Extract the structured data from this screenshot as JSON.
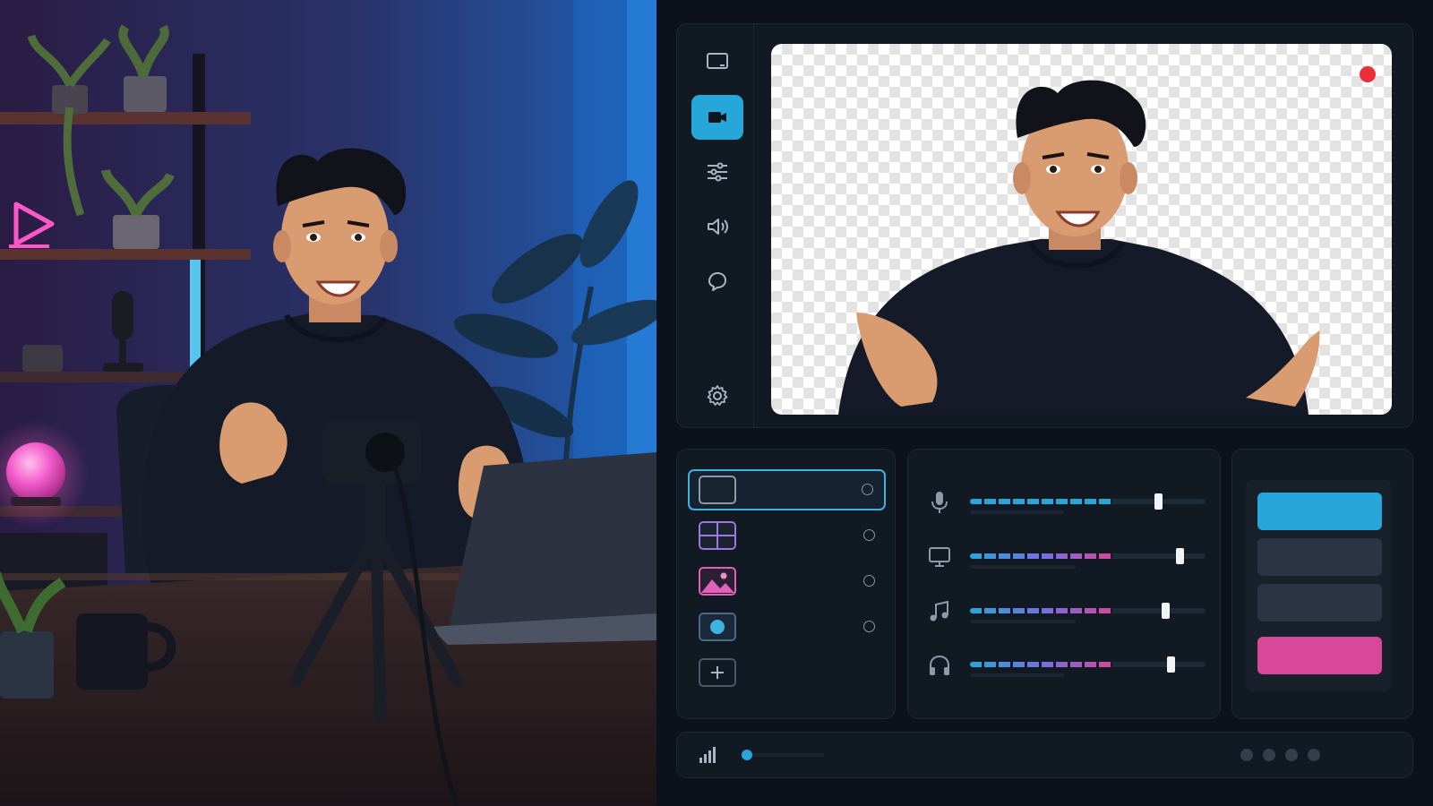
{
  "colors": {
    "accent": "#27a6d9",
    "record": "#ec2e3a",
    "scene_highlight": "#d7479a",
    "meter_gradient": [
      "#27a6d9",
      "#7a6ce0",
      "#d7479a"
    ]
  },
  "scene_illustration": {
    "neon_sign_icon": "play-icon"
  },
  "sidebar": {
    "items": [
      {
        "icon": "screen-icon",
        "active": false
      },
      {
        "icon": "video-camera-icon",
        "active": true
      },
      {
        "icon": "sliders-icon",
        "active": false
      },
      {
        "icon": "speaker-icon",
        "active": false
      },
      {
        "icon": "chat-bubble-icon",
        "active": false
      },
      {
        "icon": "gear-icon",
        "active": false
      }
    ]
  },
  "preview": {
    "recording": true,
    "background": "transparent-checkerboard"
  },
  "sources": {
    "items": [
      {
        "icon": "display-capture-icon",
        "selected": true
      },
      {
        "icon": "grid-layout-icon",
        "selected": false
      },
      {
        "icon": "image-icon",
        "selected": false
      },
      {
        "icon": "camera-source-icon",
        "selected": false
      }
    ],
    "add_icon": "plus-icon"
  },
  "mixer": {
    "channels": [
      {
        "icon": "microphone-icon",
        "level": 0.61,
        "volume": 0.8
      },
      {
        "icon": "monitor-icon",
        "level": 0.61,
        "volume": 0.89
      },
      {
        "icon": "music-note-icon",
        "level": 0.61,
        "volume": 0.83
      },
      {
        "icon": "headphones-icon",
        "level": 0.61,
        "volume": 0.85
      }
    ]
  },
  "scenes": {
    "buttons": [
      {
        "state": "active"
      },
      {
        "state": "idle"
      },
      {
        "state": "idle"
      },
      {
        "state": "highlight"
      }
    ]
  },
  "status": {
    "signal_icon": "signal-bars-icon",
    "progress": 0.04,
    "page_dots": 4
  }
}
